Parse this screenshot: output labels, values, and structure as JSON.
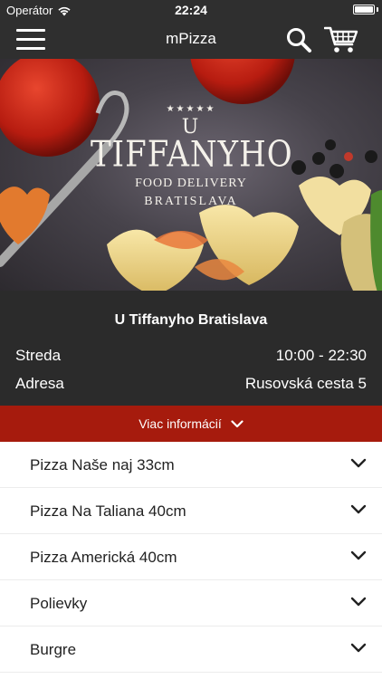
{
  "status_bar": {
    "carrier": "Operátor",
    "time": "22:24"
  },
  "nav": {
    "title": "mPizza",
    "icons": [
      "menu-icon",
      "search-icon",
      "cart-icon"
    ]
  },
  "hero": {
    "logo": {
      "top": "U",
      "name": "TIFFANYHO",
      "subtitle": "FOOD DELIVERY",
      "city": "BRATISLAVA"
    }
  },
  "info": {
    "title": "U Tiffanyho Bratislava",
    "rows": [
      {
        "label": "Streda",
        "value": "10:00 - 22:30"
      },
      {
        "label": "Adresa",
        "value": "Rusovská cesta 5"
      }
    ]
  },
  "more_info": {
    "label": "Viac informácií"
  },
  "categories": [
    {
      "label": "Pizza Naše naj 33cm"
    },
    {
      "label": "Pizza Na Taliana 40cm"
    },
    {
      "label": "Pizza Americká 40cm"
    },
    {
      "label": "Polievky"
    },
    {
      "label": "Burgre"
    }
  ],
  "colors": {
    "header": "#2f2f2f",
    "info_bg": "#2b2b2b",
    "accent": "#a61b0d"
  }
}
